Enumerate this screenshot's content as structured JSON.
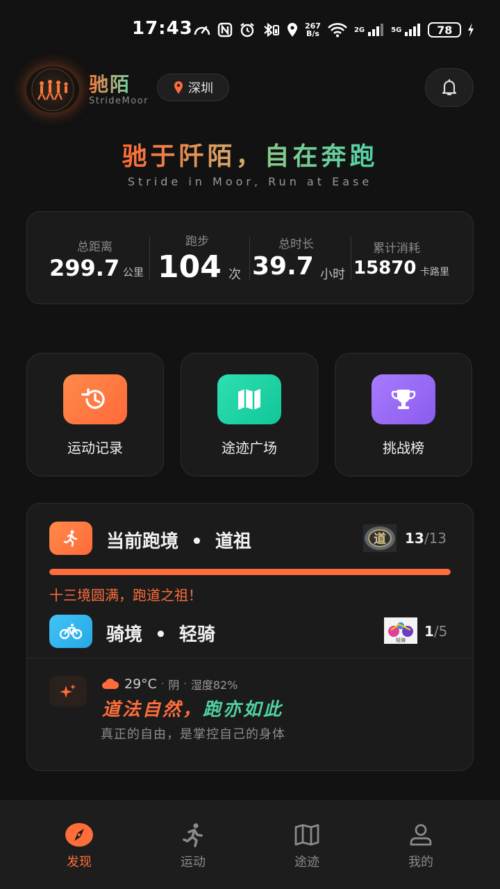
{
  "status_bar": {
    "time": "17:43",
    "net_speed_value": "267",
    "net_speed_unit": "B/s",
    "signal_1": "2G",
    "signal_2": "5G",
    "battery": "78"
  },
  "header": {
    "app_name": "驰陌",
    "app_subtitle": "StrideMoor",
    "city": "深圳"
  },
  "hero": {
    "slogan_part1": "驰于阡陌，",
    "slogan_part2": "自在奔跑",
    "tagline": "Stride in Moor, Run at Ease"
  },
  "stats": [
    {
      "label": "总距离",
      "value": "299.7",
      "unit": "公里"
    },
    {
      "label": "跑步",
      "value": "104",
      "unit": "次"
    },
    {
      "label": "总时长",
      "value": "39.7",
      "unit": "小时"
    },
    {
      "label": "累计消耗",
      "value": "15870",
      "unit": "卡路里"
    }
  ],
  "features": [
    {
      "label": "运动记录",
      "icon": "history-icon",
      "color": "#ff7040"
    },
    {
      "label": "途迹广场",
      "icon": "map-icon",
      "color": "#1fd4a4"
    },
    {
      "label": "挑战榜",
      "icon": "trophy-icon",
      "color": "#9a6cf2"
    }
  ],
  "realm": {
    "running": {
      "title_prefix": "当前跑境",
      "separator": "•",
      "title_name": "道祖",
      "badge_text": "道",
      "current": "13",
      "total": "/13",
      "progress": 1.0,
      "message": "十三境圆满，跑道之祖！"
    },
    "cycling": {
      "title_prefix": "骑境",
      "separator": "•",
      "title_name": "轻骑",
      "badge_text": "轻骑",
      "current": "1",
      "total": "/5"
    }
  },
  "daily": {
    "temperature": "29°C",
    "dot": "·",
    "condition": "阴",
    "humidity": "湿度82%",
    "quote_part1": "道法自然，",
    "quote_part2": "跑亦如此",
    "quote_sub": "真正的自由，是掌控自己的身体"
  },
  "bottom_nav": [
    {
      "label": "发现",
      "icon": "compass-icon",
      "active": true
    },
    {
      "label": "运动",
      "icon": "runner-icon",
      "active": false
    },
    {
      "label": "途迹",
      "icon": "map-icon",
      "active": false
    },
    {
      "label": "我的",
      "icon": "user-icon",
      "active": false
    }
  ],
  "colors": {
    "accent_orange": "#ff6d3b",
    "accent_green": "#4fd3a0",
    "background": "#121212",
    "card": "#1b1b1b",
    "cycling_blue": "#35b6f0"
  }
}
